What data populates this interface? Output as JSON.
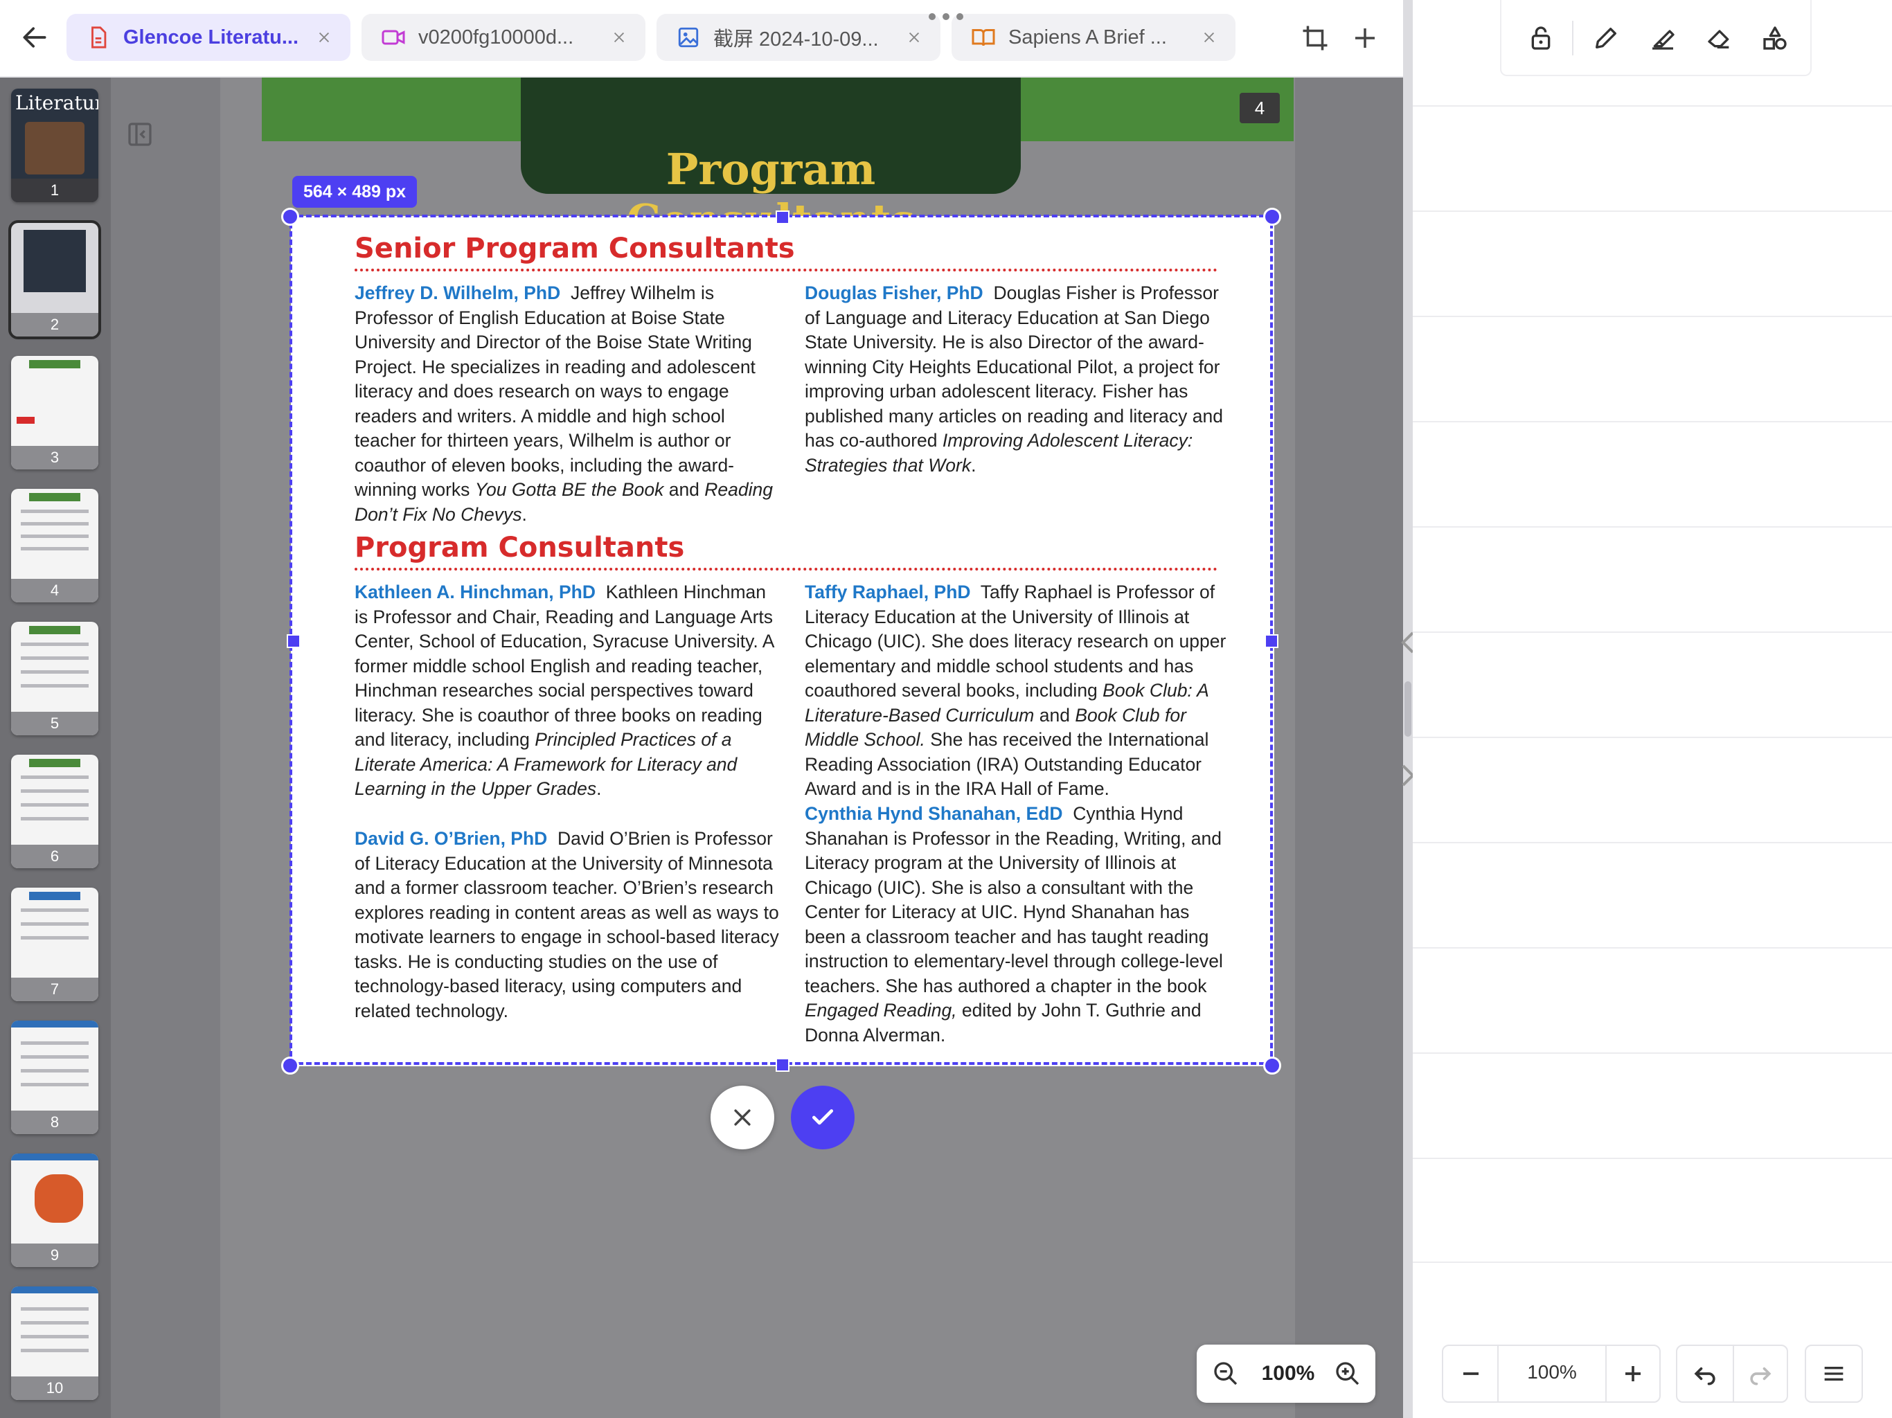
{
  "tabs": [
    {
      "label": "Glencoe Literatu...",
      "icon": "pdf-icon",
      "active": true
    },
    {
      "label": "v0200fg10000d...",
      "icon": "video-icon",
      "active": false
    },
    {
      "label": "截屏 2024-10-09...",
      "icon": "image-icon",
      "active": false
    },
    {
      "label": "Sapiens A Brief ...",
      "icon": "book-icon",
      "active": false
    }
  ],
  "thumbnails": [
    "1",
    "2",
    "3",
    "4",
    "5",
    "6",
    "7",
    "8",
    "9",
    "10"
  ],
  "thumbnail_cover_title": "Literature",
  "page": {
    "number": "4",
    "header_title": "Program Consultants",
    "senior_heading": "Senior Program Consultants",
    "program_heading": "Program Consultants",
    "bios": {
      "wilhelm": {
        "name": "Jeffrey D. Wilhelm, PhD",
        "text": "Jeffrey Wilhelm is Professor of English Education at Boise State University and Director of the Boise State Writing Project. He specializes in reading and adolescent literacy and does research on ways to engage readers and writers. A middle and high school teacher for thirteen years, Wilhelm is author or coauthor of eleven books, including the award-winning works ",
        "i1": "You Gotta BE the Book",
        "mid": " and ",
        "i2": "Reading Don’t Fix No Chevys",
        "end": "."
      },
      "fisher": {
        "name": "Douglas Fisher, PhD",
        "text": "Douglas Fisher is Professor of Language and Literacy Education at San Diego State University. He is also Director of the award-winning City Heights Educational Pilot, a project for improving urban adolescent literacy. Fisher has published many articles on reading and literacy and has co-authored ",
        "i1": "Improving Adolescent Literacy: Strategies that Work",
        "end": "."
      },
      "hinchman": {
        "name": "Kathleen A. Hinchman, PhD",
        "text": "Kathleen Hinchman is Professor and Chair, Reading and Language Arts Center, School of Education, Syracuse University. A former middle school English and reading teacher, Hinchman researches social perspectives toward literacy. She is coauthor of three books on reading and literacy, including ",
        "i1": "Principled Practices of a Literate America: A Framework for Literacy and Learning in the Upper Grades",
        "end": "."
      },
      "obrien": {
        "name": "David G. O’Brien, PhD",
        "text": "David O’Brien is Professor of Literacy Education at the University of Minnesota and a former classroom teacher. O’Brien’s research explores reading in content areas as well as ways to motivate learners to engage in school-based literacy tasks. He is conducting studies on the use of technology-based literacy, using computers and related technology."
      },
      "raphael": {
        "name": "Taffy Raphael, PhD",
        "text": "Taffy Raphael is Professor of Literacy Education at the University of Illinois at Chicago (UIC). She does literacy research on upper elementary and middle school students and has coauthored several books, including ",
        "i1": "Book Club: A Literature-Based Curriculum",
        "mid": " and ",
        "i2": "Book Club for Middle School.",
        "end": " She has received the International Reading Association (IRA) Outstanding Educator Award and is in the IRA Hall of Fame."
      },
      "shanahan": {
        "name": "Cynthia Hynd Shanahan, EdD",
        "text": "Cynthia Hynd Shanahan is Professor in the Reading, Writing, and Literacy program at the University of Illinois at Chicago (UIC). She is also a consultant with the Center for Literacy at UIC. Hynd Shanahan has been a classroom teacher and has taught reading instruction to elementary-level through college-level teachers. She has authored a chapter in the book ",
        "i1": "Engaged Reading,",
        "end": " edited by John T. Guthrie and Donna Alverman."
      }
    }
  },
  "selection": {
    "size_label": "564 × 489 px"
  },
  "zoom": {
    "value": "100%"
  },
  "right_panel": {
    "zoom_value": "100%"
  },
  "colors": {
    "accent": "#4d3ff2",
    "heading_red": "#d72b2b",
    "name_blue": "#1f78c8"
  }
}
